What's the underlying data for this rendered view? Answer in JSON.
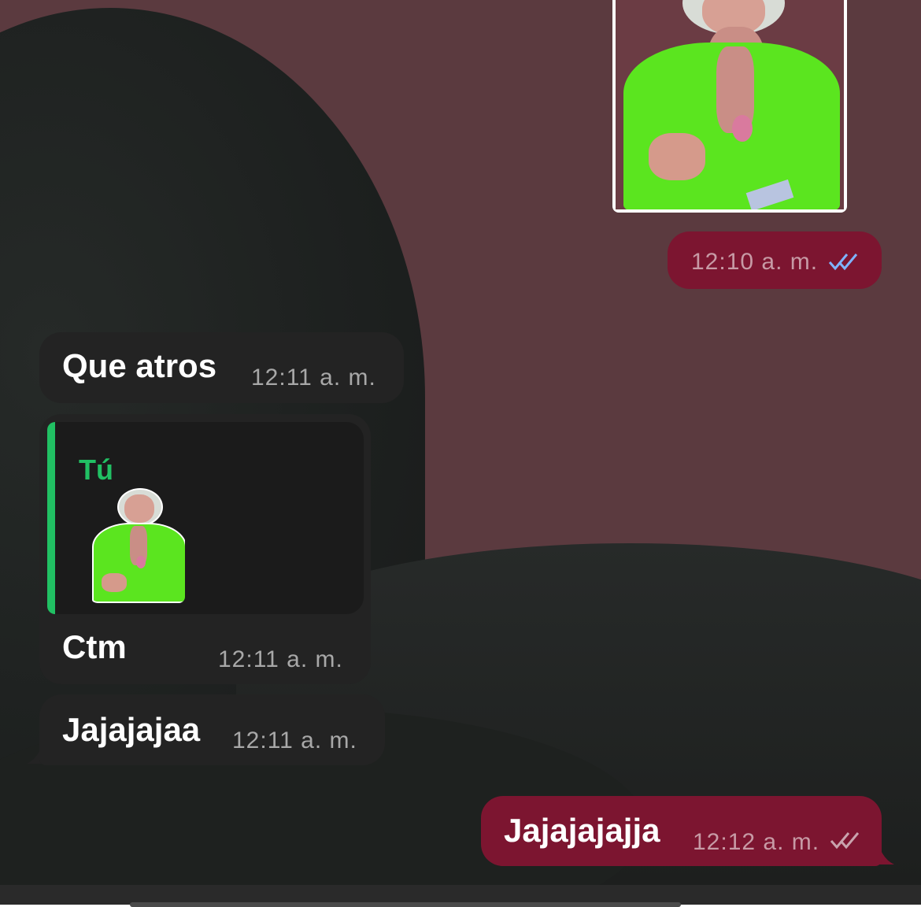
{
  "chat": {
    "messages": [
      {
        "id": "m1",
        "direction": "outgoing",
        "type": "sticker",
        "time": "12:10 a. m.",
        "status": "read"
      },
      {
        "id": "m2",
        "direction": "incoming",
        "type": "text",
        "text": "Que atros",
        "time": "12:11 a. m."
      },
      {
        "id": "m3",
        "direction": "incoming",
        "type": "reply",
        "quote_author": "Tú",
        "quote_type": "sticker",
        "text": "Ctm",
        "time": "12:11 a. m."
      },
      {
        "id": "m4",
        "direction": "incoming",
        "type": "text",
        "text": "Jajajajaa",
        "time": "12:11 a. m."
      },
      {
        "id": "m5",
        "direction": "outgoing",
        "type": "text",
        "text": "Jajajajajja",
        "time": "12:12 a. m.",
        "status": "delivered"
      }
    ]
  },
  "colors": {
    "incoming_bubble": "#232323",
    "outgoing_bubble": "#7c1530",
    "reply_accent": "#21c063",
    "read_ticks": "#7fb3ff",
    "delivered_ticks": "#c9a3ad"
  },
  "icons": {
    "read": "double-check-icon",
    "delivered": "double-check-icon"
  }
}
